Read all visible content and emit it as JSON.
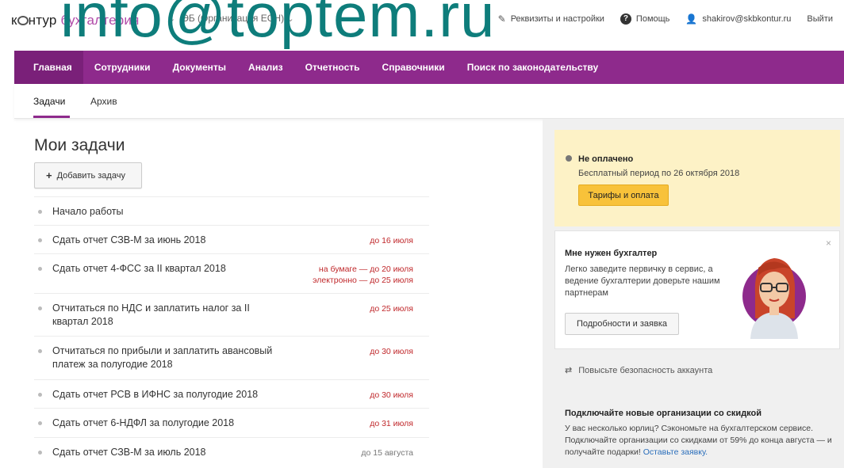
{
  "header": {
    "logo_prefix": "к",
    "logo_mid": "нтур",
    "logo_accent": "бухгалтерия",
    "org_name": "ЭБ (Организация ЕСН)",
    "settings_label": "Реквизиты и настройки",
    "help_label": "Помощь",
    "user_email": "shakirov@skbkontur.ru",
    "logout_label": "Выйти"
  },
  "watermark": "info@toptem.ru",
  "nav": {
    "items": [
      {
        "label": "Главная"
      },
      {
        "label": "Сотрудники"
      },
      {
        "label": "Документы"
      },
      {
        "label": "Анализ"
      },
      {
        "label": "Отчетность"
      },
      {
        "label": "Справочники"
      },
      {
        "label": "Поиск по законодательству"
      }
    ]
  },
  "subtabs": [
    {
      "label": "Задачи"
    },
    {
      "label": "Архив"
    }
  ],
  "main": {
    "title": "Мои задачи",
    "add_button": "Добавить задачу",
    "tasks": [
      {
        "title": "Начало работы",
        "due": ""
      },
      {
        "title": "Сдать отчет СЗВ-М за июнь 2018",
        "due": "до 16 июля"
      },
      {
        "title": "Сдать отчет 4-ФСС за II квартал 2018",
        "due": "на бумаге — до 20 июля",
        "due2": "электронно — до 25 июля"
      },
      {
        "title": "Отчитаться по НДС и заплатить налог за II квартал 2018",
        "due": "до 25 июля"
      },
      {
        "title": "Отчитаться по прибыли и заплатить авансовый платеж за полугодие 2018",
        "due": "до 30 июля"
      },
      {
        "title": "Сдать отчет РСВ в ИФНС за полугодие 2018",
        "due": "до 30 июля"
      },
      {
        "title": "Сдать отчет 6-НДФЛ за полугодие 2018",
        "due": "до 31 июля"
      },
      {
        "title": "Сдать отчет СЗВ-М за июль 2018",
        "due": "до 15 августа"
      }
    ]
  },
  "sidebar": {
    "payment": {
      "title": "Не оплачено",
      "subtitle": "Бесплатный период по 26 октября 2018",
      "button": "Тарифы и оплата"
    },
    "accountant": {
      "title": "Мне нужен бухгалтер",
      "text": "Легко заведите первичку в сервис, а ведение бухгалтерии доверьте нашим партнерам",
      "button": "Подробности и заявка",
      "close": "×"
    },
    "security": "Повысьте безопасность аккаунта",
    "promo": {
      "title": "Подключайте новые организации со скидкой",
      "text": "У вас несколько юрлиц? Сэкономьте на бухгалтерском сервисе. Подключайте организации со скидками от 59% до конца августа — и получайте подарки!",
      "link": "Оставьте заявку."
    }
  },
  "colors": {
    "nav_bg": "#8e2a8c",
    "pay_bg": "#fdf2c6",
    "pay_button": "#f8c23a",
    "due_red": "#c0282b",
    "link": "#2a6ebb"
  }
}
